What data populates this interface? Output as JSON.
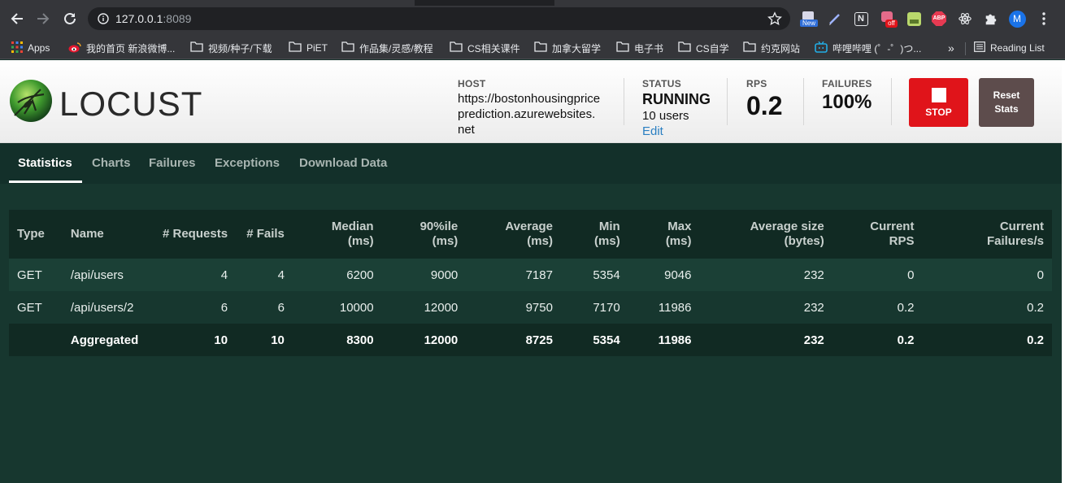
{
  "browser": {
    "url_host": "127.0.0.1",
    "url_port": ":8089",
    "extensions": [
      "new-badge-extension",
      "pen-extension",
      "notion-extension",
      "off-badge-extension",
      "game-extension",
      "abp-extension",
      "react-extension",
      "puzzle-extension",
      "profile-avatar"
    ],
    "ext_new_badge": "New",
    "ext_off_badge": "off",
    "ext_abp_text": "ABP",
    "ext_notion_text": "N",
    "avatar_letter": "M"
  },
  "bookmarks": {
    "apps": "Apps",
    "items": [
      "我的首页 新浪微博...",
      "视频/种子/下载",
      "PiET",
      "作品集/灵感/教程",
      "CS相关课件",
      "加拿大留学",
      "电子书",
      "CS自学",
      "约克网站",
      "哔哩哔哩 (゜-゜)つ..."
    ],
    "overflow": "»",
    "reading_list": "Reading List"
  },
  "header": {
    "logo_text": "LOCUST",
    "host_label": "HOST",
    "host_value": "https://bostonhousingprice prediction.azurewebsites. net",
    "host_line1": "https://bostonhousingprice",
    "host_line2": "prediction.azurewebsites.",
    "host_line3": "net",
    "status_label": "STATUS",
    "status_value": "RUNNING",
    "users": "10 users",
    "edit": "Edit",
    "rps_label": "RPS",
    "rps_value": "0.2",
    "failures_label": "FAILURES",
    "failures_value": "100%",
    "stop": "STOP",
    "reset_line1": "Reset",
    "reset_line2": "Stats"
  },
  "tabs": [
    "Statistics",
    "Charts",
    "Failures",
    "Exceptions",
    "Download Data"
  ],
  "table": {
    "headers": [
      [
        "Type"
      ],
      [
        "Name"
      ],
      [
        "# Requests"
      ],
      [
        "# Fails"
      ],
      [
        "Median",
        "(ms)"
      ],
      [
        "90%ile",
        "(ms)"
      ],
      [
        "Average",
        "(ms)"
      ],
      [
        "Min",
        "(ms)"
      ],
      [
        "Max",
        "(ms)"
      ],
      [
        "Average size",
        "(bytes)"
      ],
      [
        "Current",
        "RPS"
      ],
      [
        "Current",
        "Failures/s"
      ]
    ],
    "rows": [
      [
        "GET",
        "/api/users",
        "4",
        "4",
        "6200",
        "9000",
        "7187",
        "5354",
        "9046",
        "232",
        "0",
        "0"
      ],
      [
        "GET",
        "/api/users/2",
        "6",
        "6",
        "10000",
        "12000",
        "9750",
        "7170",
        "11986",
        "232",
        "0.2",
        "0.2"
      ]
    ],
    "aggregate": [
      "",
      "Aggregated",
      "10",
      "10",
      "8300",
      "12000",
      "8725",
      "5354",
      "11986",
      "232",
      "0.2",
      "0.2"
    ]
  },
  "colors": {
    "stop_button": "#e0141a",
    "reset_button": "#5d4c4c",
    "page_background": "#15302a",
    "edit_link": "#2a7fc2"
  }
}
